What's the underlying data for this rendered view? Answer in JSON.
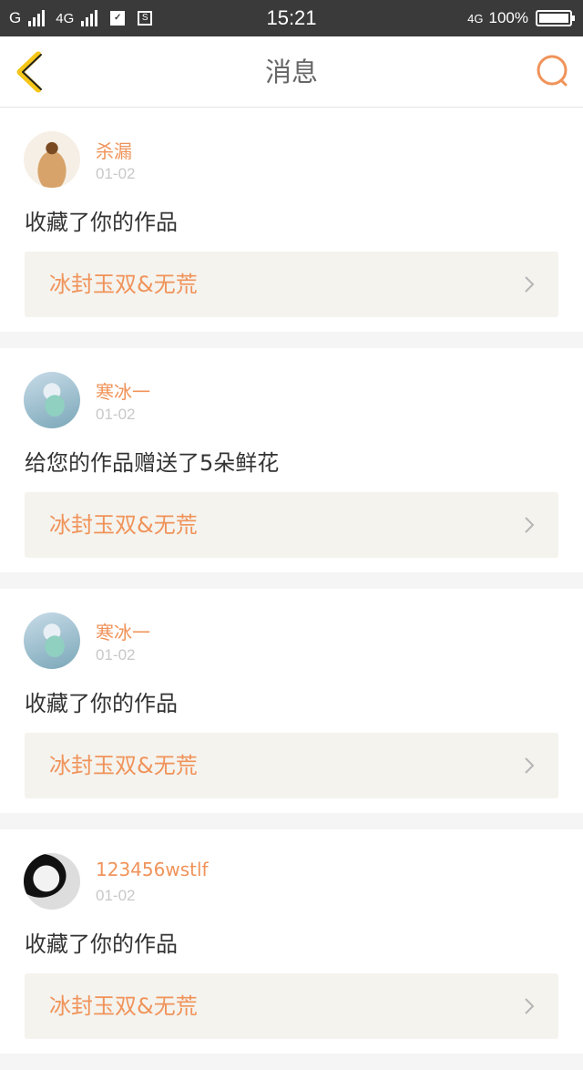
{
  "status_bar": {
    "carrier1": "G",
    "carrier2": "4G",
    "time": "15:21",
    "network": "4G",
    "battery": "100%"
  },
  "nav": {
    "title": "消息",
    "back_icon": "chevron-left-icon",
    "search_icon": "search-icon"
  },
  "colors": {
    "accent": "#f0935a",
    "back": "#f5c518",
    "status_bar": "#3a3a3a"
  },
  "messages": [
    {
      "username": "杀漏",
      "date": "01-02",
      "action": "收藏了你的作品",
      "work_title": "冰封玉双&无荒"
    },
    {
      "username": "寒冰一",
      "date": "01-02",
      "action": "给您的作品赠送了5朵鲜花",
      "work_title": "冰封玉双&无荒"
    },
    {
      "username": "寒冰一",
      "date": "01-02",
      "action": "收藏了你的作品",
      "work_title": "冰封玉双&无荒"
    },
    {
      "username": "123456wstlf",
      "date": "01-02",
      "action": "收藏了你的作品",
      "work_title": "冰封玉双&无荒"
    }
  ]
}
